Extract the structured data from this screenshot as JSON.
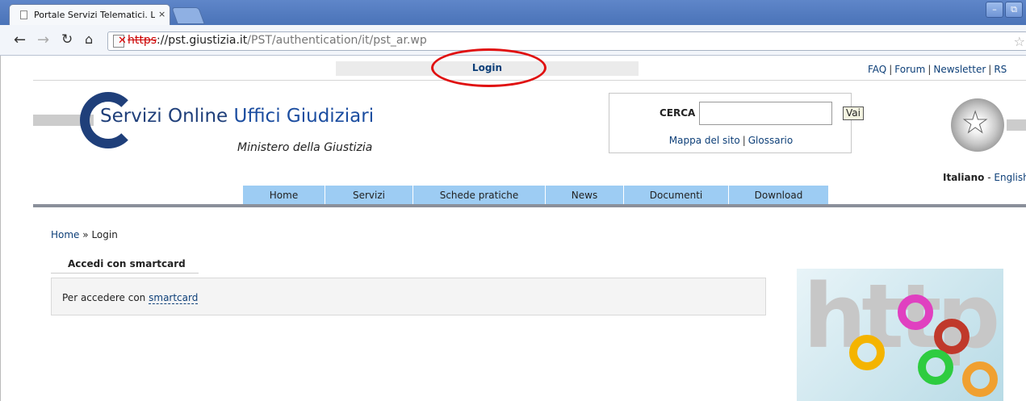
{
  "browser": {
    "tab_title": "Portale Servizi Telematici. Lo",
    "tab_close": "×",
    "url_scheme": "https",
    "url_host": "://pst.giustizia.it",
    "url_path": "/PST/authentication/it/pst_ar.wp",
    "minimize": "–",
    "maximize": "⧉"
  },
  "topbar": {
    "login_label": "Login",
    "links": [
      "FAQ",
      "Forum",
      "Newsletter",
      "RS"
    ]
  },
  "header": {
    "logo_part1": "Servizi Online",
    "logo_part2": "Uffici Giudiziari",
    "ministry": "Ministero della Giustizia",
    "search": {
      "label": "CERCA",
      "value": "",
      "button": "Vai",
      "link_map": "Mappa del sito",
      "link_glossary": "Glossario"
    },
    "lang_current": "Italiano",
    "lang_separator": "-",
    "lang_other": "English"
  },
  "nav": [
    "Home",
    "Servizi",
    "Schede pratiche",
    "News",
    "Documenti",
    "Download"
  ],
  "breadcrumb": {
    "home": "Home",
    "sep": "»",
    "current": "Login"
  },
  "section": {
    "title": "Accedi con smartcard",
    "text": "Per accedere con",
    "link": "smartcard"
  },
  "image": {
    "bg_text": "http:"
  },
  "colors": {
    "link": "#0d3f78",
    "nav_tab": "#9dccf3",
    "annotation_circle": "#e01010"
  }
}
